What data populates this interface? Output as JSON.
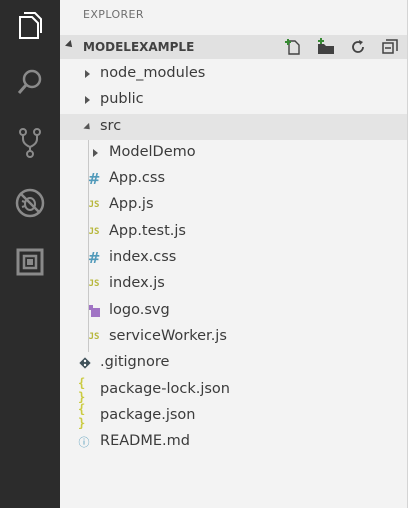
{
  "activity_bar": {
    "items": [
      {
        "icon": "files-icon"
      },
      {
        "icon": "search-icon"
      },
      {
        "icon": "source-control-icon"
      },
      {
        "icon": "debug-icon"
      },
      {
        "icon": "extensions-icon"
      }
    ]
  },
  "explorer": {
    "title": "EXPLORER",
    "section_title": "MODELEXAMPLE",
    "actions": [
      "new-file-icon",
      "new-folder-icon",
      "refresh-icon",
      "collapse-all-icon"
    ]
  },
  "tree": {
    "node_modules": "node_modules",
    "public": "public",
    "src": "src",
    "model_demo": "ModelDemo",
    "app_css": "App.css",
    "app_js": "App.js",
    "app_test_js": "App.test.js",
    "index_css": "index.css",
    "index_js": "index.js",
    "logo_svg": "logo.svg",
    "service_worker_js": "serviceWorker.js",
    "gitignore": ".gitignore",
    "package_lock_json": "package-lock.json",
    "package_json": "package.json",
    "readme_md": "README.md"
  },
  "icon_glyphs": {
    "js": "JS",
    "css": "#",
    "json": "{ }",
    "info": "ⓘ"
  },
  "colors": {
    "activity_bar_bg": "#2c2c2c",
    "sidebar_bg": "#f3f3f3",
    "section_header_bg": "#e1e1e1",
    "selected_row_bg": "#e4e4e4",
    "js_icon": "#b7b73b",
    "css_icon": "#519aba",
    "json_icon": "#cbcb41",
    "svg_icon": "#a074c4"
  }
}
